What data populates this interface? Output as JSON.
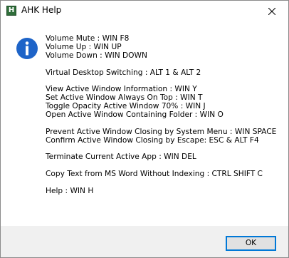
{
  "window": {
    "title": "AHK Help",
    "app_icon_glyph": "H",
    "app_icon_name": "autohotkey-icon",
    "close_icon_name": "close-icon",
    "info_icon_name": "information-icon",
    "info_icon_color": "#1e64c8",
    "info_icon_glyph": "i"
  },
  "message": {
    "lines": [
      "Volume Mute : WIN F8",
      "Volume Up : WIN UP",
      "Volume Down : WIN DOWN",
      "",
      "Virtual Desktop Switching : ALT 1 & ALT 2",
      "",
      "View Active Window Information : WIN Y",
      "Set Active Window Always On Top : WIN T",
      "Toggle Opacity Active Window 70% : WIN J",
      "Open Active Window Containing Folder : WIN O",
      "",
      "Prevent Active Window Closing by System Menu : WIN SPACE",
      "Confirm Active Window Closing by Escape: ESC & ALT F4",
      "",
      "Terminate Current Active App : WIN DEL",
      "",
      "Copy Text from MS Word Without Indexing : CTRL SHIFT C",
      "",
      "Help : WIN H"
    ]
  },
  "buttons": {
    "ok_label": "OK",
    "accent_color": "#0078d7"
  }
}
